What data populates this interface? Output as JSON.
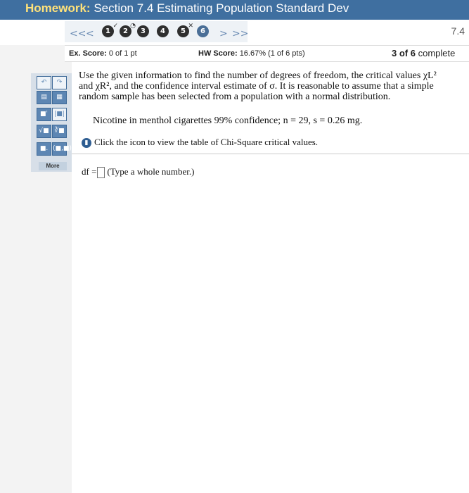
{
  "window": {
    "title_label": "Homework:",
    "title_text": "Section 7.4 Estimating Population Standard Dev",
    "corner_text": "7.4"
  },
  "nav": {
    "first": "<<",
    "prev": "<",
    "next": ">",
    "last": ">>",
    "questions": [
      "1",
      "2",
      "3",
      "4",
      "5",
      "6"
    ]
  },
  "score": {
    "ex_label": "Ex. Score:",
    "ex_value": "0 of 1 pt",
    "hw_label": "HW Score:",
    "hw_value": "16.67% (1 of 6 pts)",
    "progress_count": "3 of 6",
    "progress_word": "complete"
  },
  "toolbar": {
    "more_label": "More"
  },
  "question": {
    "line1": "Use the given information to find the number of degrees of freedom, the critical values χL²",
    "line2": "and χR², and the confidence interval estimate of σ. It is reasonable to assume that a simple",
    "line3": "random sample has been selected from a population with a normal distribution.",
    "given": "Nicotine in menthol cigarettes 99% confidence; n = 29, s = 0.26 mg.",
    "icon_text": "Click the icon to view the table of Chi-Square critical values."
  },
  "answer": {
    "prefix": "df =",
    "hint": "(Type a whole number.)",
    "value": ""
  },
  "colors": {
    "titlebar": "#3f6fa0",
    "title_label": "#ffe27a",
    "accent": "#5d86b3"
  }
}
